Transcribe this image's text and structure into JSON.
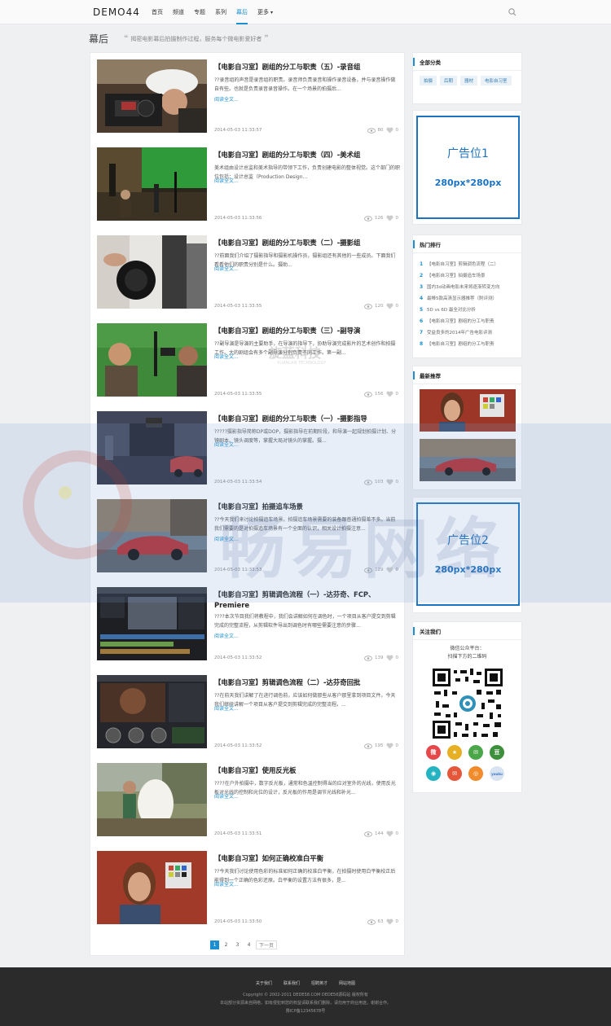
{
  "header": {
    "logo": "DEMO44",
    "nav": [
      {
        "label": "首页",
        "active": false
      },
      {
        "label": "频道",
        "active": false
      },
      {
        "label": "专题",
        "active": false
      },
      {
        "label": "系列",
        "active": false
      },
      {
        "label": "幕后",
        "active": true
      },
      {
        "label": "更多",
        "active": false
      }
    ],
    "search_placeholder": ""
  },
  "page": {
    "title": "幕后",
    "desc": "揭密电影幕后拍摄制作过程，服务每个微电影爱好者"
  },
  "posts": [
    {
      "title": "【电影自习室】剧组的分工与职责（五）-录音组",
      "excerpt": "??录音组的声音是录音组的职责。录音师负责录音和操作录音设备，并与录音操作做自有些。也就是负责录音录音操作。在一个场景的拍摄后...",
      "more": "阅读全文...",
      "date": "2014-05-03 11:33:57",
      "views": "80",
      "likes": "0",
      "icon": "camera-operator"
    },
    {
      "title": "【电影自习室】剧组的分工与职责（四）-美术组",
      "excerpt": "美术组由设计总监和美术指导的带领下工作，负责创建电影的整体视觉。这个部门的职位包括：设计总监（Production Design...",
      "more": "阅读全文...",
      "date": "2014-05-03 11:33:56",
      "views": "126",
      "likes": "0",
      "icon": "green-screen"
    },
    {
      "title": "【电影自习室】剧组的分工与职责（二）-摄影组",
      "excerpt": "??前面我们介绍了摄影指导和摄影机操作员，摄影组还有其他的一些成员。下面我们看看他们的职责分别是什么。摄助...",
      "more": "阅读全文...",
      "date": "2014-05-03 11:33:55",
      "views": "120",
      "likes": "0",
      "icon": "camera-crew"
    },
    {
      "title": "【电影自习室】剧组的分工与职责（三）-副导演",
      "excerpt": "??副导演是导演的主要助手，在导演的指导下，协助导演完成影片的艺术创作和拍摄工作。大的剧组会有多个副导演分别负责不同工作。第一副...",
      "more": "阅读全文...",
      "date": "2014-05-03 11:33:55",
      "views": "156",
      "likes": "0",
      "icon": "assistant-director"
    },
    {
      "title": "【电影自习室】剧组的分工与职责（一）-摄影指导",
      "excerpt": "?????摄影指导简称DP或DOP，摄影指导在前期阶段，和导演一起规划拍摄计划、分镜剧本、镜头调度等，掌握大局对镜头的掌握。摄...",
      "more": "阅读全文...",
      "date": "2014-05-03 11:33:54",
      "views": "103",
      "likes": "0",
      "icon": "dolly-shot"
    },
    {
      "title": "【电影自习室】拍摄追车场景",
      "excerpt": "??今天我们来讨论拍摄追车场景。拍摄追车场景需要的装备跟普通拍摄差不多。当前我们需要的是对拍摄追车场景有一个全面的认识，相关设计拍摄注意...",
      "more": "阅读全文...",
      "date": "2014-05-03 11:33:53",
      "views": "129",
      "likes": "0",
      "icon": "car-chase"
    },
    {
      "title": "【电影自习室】剪辑调色流程（一）-达芬奇、FCP、Premiere",
      "excerpt": "????本次节目我们将教程中，我们会讲解如何在调色时，一个项目从客户提交到剪辑完成的完整流程，从剪辑软件导出到调色时有哪些需要注意的步骤...",
      "more": "阅读全文...",
      "date": "2014-05-03 11:33:52",
      "views": "139",
      "likes": "0",
      "icon": "editing-software"
    },
    {
      "title": "【电影自习室】剪辑调色流程（二）-达芬奇回批",
      "excerpt": "??在前天我们讲解了在进行调色前，应该如何做那些从客户那里拿到项目文件。今天我们继续讲解一个项目从客户提交到剪辑完成的完整流程。...",
      "more": "阅读全文...",
      "date": "2014-05-03 11:33:52",
      "views": "195",
      "likes": "0",
      "icon": "color-grading"
    },
    {
      "title": "【电影自习室】使用反光板",
      "excerpt": "????在户外拍摄中，数字反光板，通常和色温控制得当的应对室外的光线，使用反光板对光线的控制和光位的设计，反光板的作用是调节光线和补光...",
      "more": "阅读全文...",
      "date": "2014-05-03 11:33:51",
      "views": "144",
      "likes": "0",
      "icon": "reflector"
    },
    {
      "title": "【电影自习室】如何正确校准白平衡",
      "excerpt": "??今天我们讨论使用色彩的标准如何正确的校准白平衡，在拍摄时使用白平衡校正后能得到一个正确的色彩还原。白平衡的设置方法有很多，是...",
      "more": "阅读全文...",
      "date": "2014-05-03 11:33:50",
      "views": "63",
      "likes": "0",
      "icon": "white-balance"
    }
  ],
  "pagination": {
    "pages": [
      "1",
      "2",
      "3",
      "4"
    ],
    "next": "下一页"
  },
  "sidebar": {
    "categories": {
      "title": "全部分类",
      "tags": [
        "拍摄",
        "后期",
        "器材",
        "电影自习室"
      ]
    },
    "ad1": {
      "line1": "广告位1",
      "line2": "280px*280px"
    },
    "hot": {
      "title": "热门排行",
      "items": [
        "【电影自习室】剪辑调色流程（二）",
        "【电影自习室】拍摄追车场景",
        "国内3d动画电影未来将逐渐转变方向",
        "最棒5款高清显示器推荐（附评测）",
        "5D vs 6D 最全对比分析",
        "【电影自习室】剧组的分工与职责",
        "受益良多的2014年广告电影评测",
        "【电影自习室】剧组的分工与职责"
      ]
    },
    "recommend": {
      "title": "最新推荐"
    },
    "ad2": {
      "line1": "广告位2",
      "line2": "280px*280px"
    },
    "follow": {
      "title": "关注我们",
      "line1": "微信公众平台：",
      "line2": "扫描下方的二维码"
    }
  },
  "footer": {
    "links": [
      "关于我们",
      "联系我们",
      "招聘英才",
      "网站地图"
    ],
    "copyright": "Copyright © 2002-2011 DEDE58.COM DEDE58源码站 版权所有",
    "disclaimer": "本站部分资源来自网络，如有侵犯到您的权益请联系我们删除，请勿用于商业用途，谢谢合作。",
    "icp": "豫ICP备12345678号"
  },
  "watermarks": {
    "center": "旋蓝科技",
    "center_sub": "XUANLAN TECHNOLOGY",
    "band": "畅易网络"
  }
}
